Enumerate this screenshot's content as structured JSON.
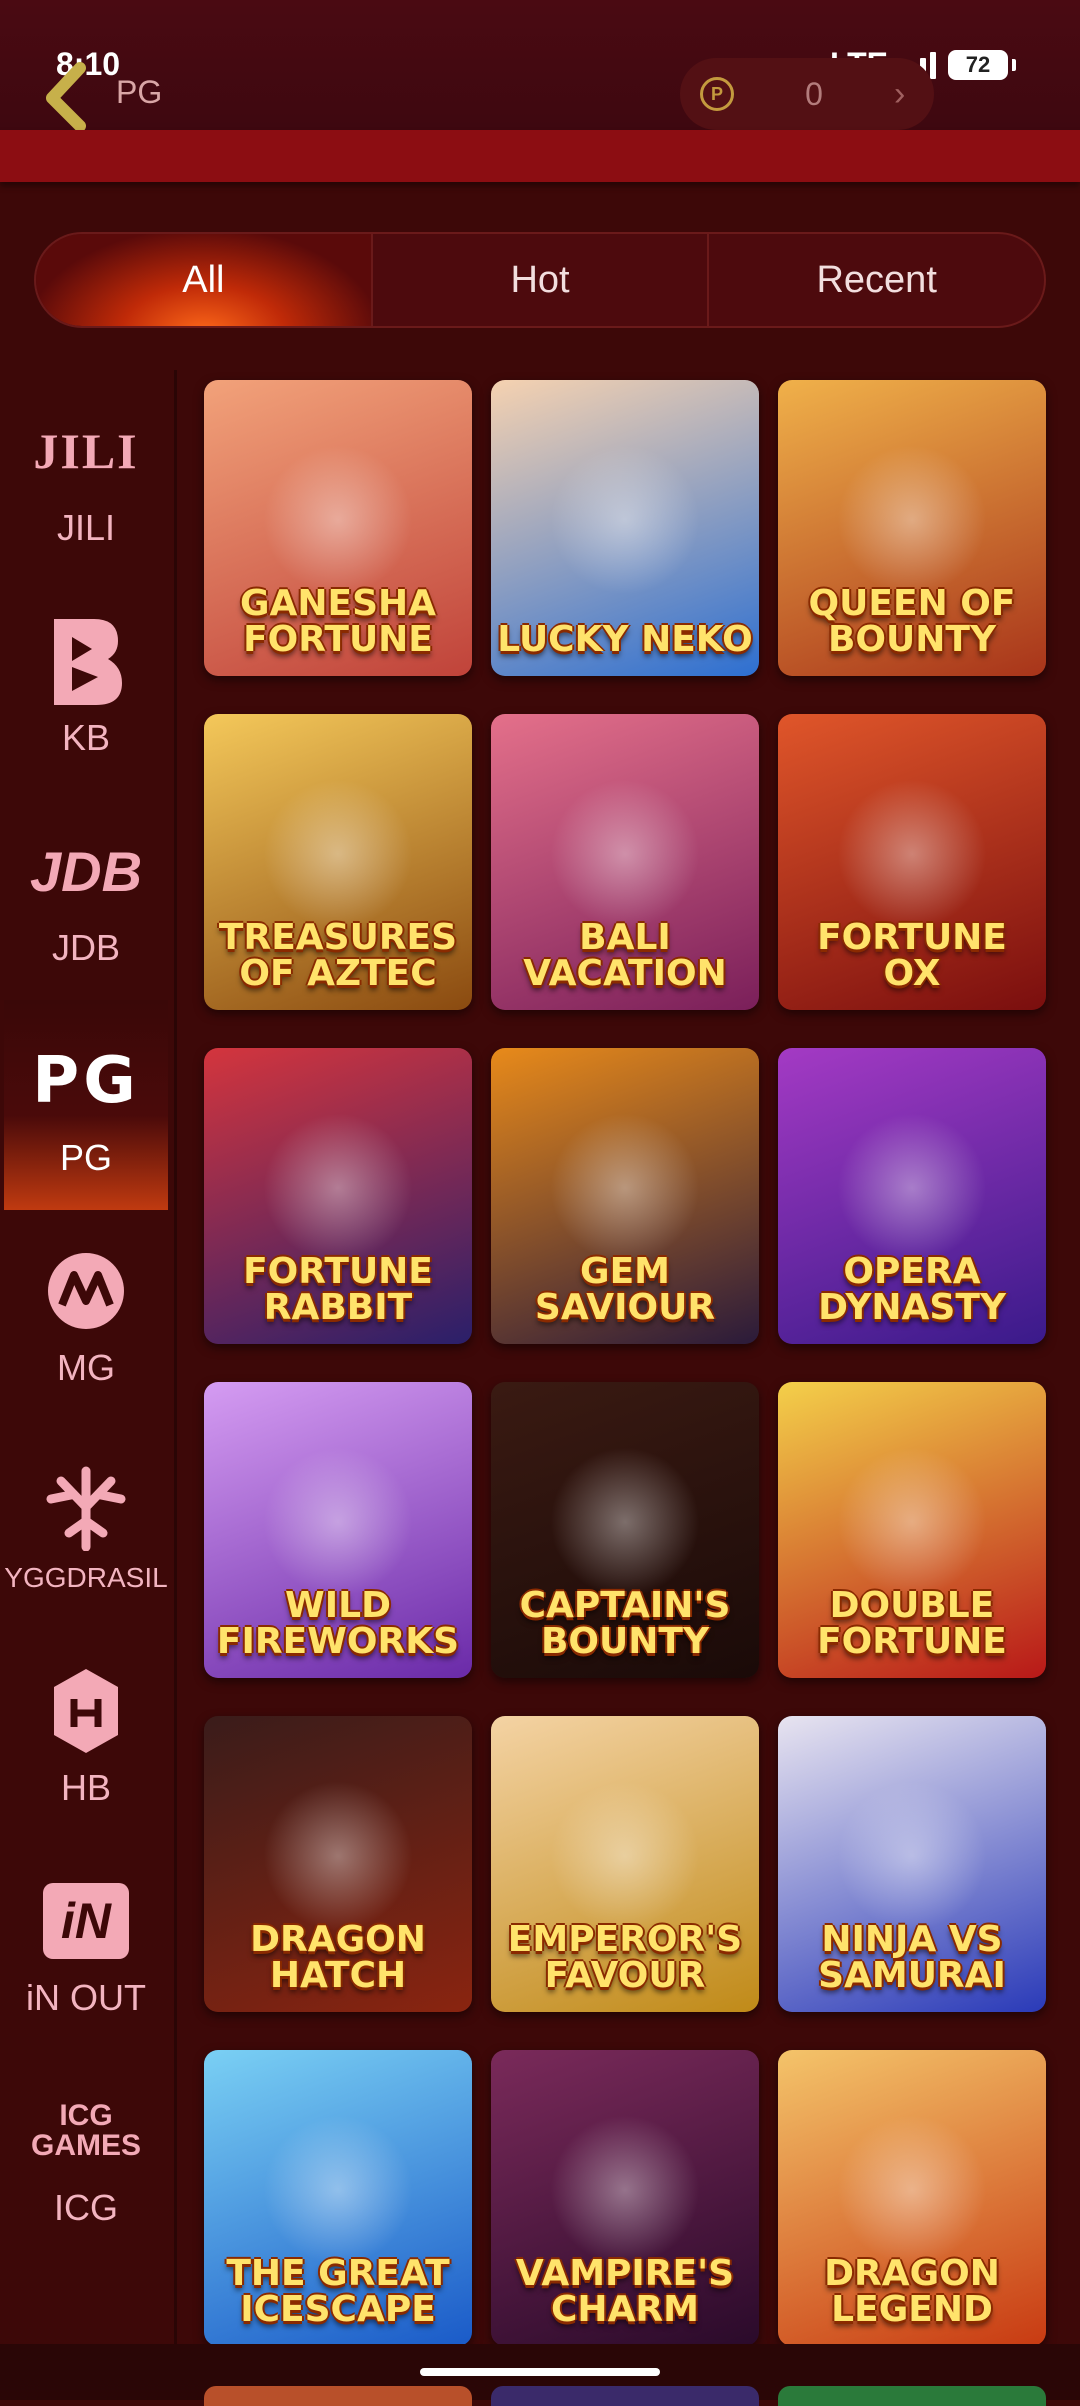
{
  "status": {
    "time": "8:10",
    "network": "LTE",
    "battery": "72"
  },
  "header": {
    "title": "PG",
    "balance": "0"
  },
  "tabs": [
    {
      "label": "All",
      "active": true
    },
    {
      "label": "Hot",
      "active": false
    },
    {
      "label": "Recent",
      "active": false
    }
  ],
  "providers": [
    {
      "logo": "JILI",
      "label": "JILI"
    },
    {
      "logo": "KB",
      "label": "KB"
    },
    {
      "logo": "JDB",
      "label": "JDB"
    },
    {
      "logo": "PG",
      "label": "PG",
      "active": true
    },
    {
      "logo": "MG",
      "label": "MG"
    },
    {
      "logo": "YGG",
      "label": "YGGDRASIL"
    },
    {
      "logo": "HB",
      "label": "HB"
    },
    {
      "logo": "iN",
      "label": "iN OUT"
    },
    {
      "logo": "ICG GAMES",
      "label": "ICG"
    }
  ],
  "games": [
    {
      "name": "GANESHA FORTUNE",
      "bg": [
        "#f2a27a",
        "#c0433a"
      ]
    },
    {
      "name": "LUCKY NEKO",
      "bg": [
        "#f6d2b0",
        "#2d6fd1"
      ]
    },
    {
      "name": "QUEEN OF BOUNTY",
      "bg": [
        "#f0b14a",
        "#a8341a"
      ]
    },
    {
      "name": "TREASURES OF AZTEC",
      "bg": [
        "#f4c85a",
        "#8a4a10"
      ]
    },
    {
      "name": "BALI VACATION",
      "bg": [
        "#e4708a",
        "#7a1f5a"
      ]
    },
    {
      "name": "FORTUNE OX",
      "bg": [
        "#e0562a",
        "#7a0e0e"
      ]
    },
    {
      "name": "FORTUNE RABBIT",
      "bg": [
        "#d4353d",
        "#2a1f6a"
      ]
    },
    {
      "name": "GEM SAVIOUR",
      "bg": [
        "#e88a1a",
        "#2a1a3a"
      ]
    },
    {
      "name": "OPERA DYNASTY",
      "bg": [
        "#a43ac4",
        "#3a1a8a"
      ]
    },
    {
      "name": "WILD FIREWORKS",
      "bg": [
        "#d59cf2",
        "#6a2aa8"
      ]
    },
    {
      "name": "CAPTAIN'S BOUNTY",
      "bg": [
        "#3a1a12",
        "#1a0a08"
      ]
    },
    {
      "name": "DOUBLE FORTUNE",
      "bg": [
        "#f4d04a",
        "#b81818"
      ]
    },
    {
      "name": "DRAGON HATCH",
      "bg": [
        "#3a1c1a",
        "#8a2410"
      ]
    },
    {
      "name": "EMPEROR'S FAVOUR",
      "bg": [
        "#f4d3a4",
        "#c08a18"
      ]
    },
    {
      "name": "NINJA VS SAMURAI",
      "bg": [
        "#e8e4f0",
        "#2a3ab8"
      ]
    },
    {
      "name": "THE GREAT ICESCAPE",
      "bg": [
        "#7ad0f4",
        "#1a5ac8"
      ]
    },
    {
      "name": "VAMPIRE'S CHARM",
      "bg": [
        "#7a2a5a",
        "#2a0a2a"
      ]
    },
    {
      "name": "DRAGON LEGEND",
      "bg": [
        "#f4c46a",
        "#c83a12"
      ]
    }
  ]
}
